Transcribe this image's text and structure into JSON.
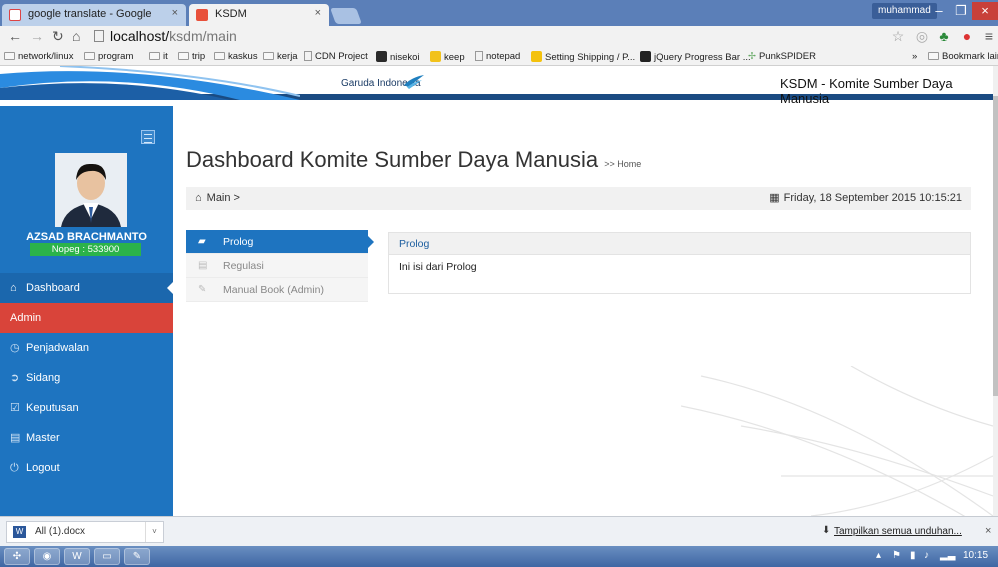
{
  "browser": {
    "tabs": [
      {
        "title": "google translate - Google",
        "active": false
      },
      {
        "title": "KSDM",
        "active": true
      }
    ],
    "user_badge": "muhammad",
    "url_host": "localhost/",
    "url_path": "ksdm/main",
    "bookmarks": [
      {
        "label": "network/linux",
        "kind": "folder"
      },
      {
        "label": "program",
        "kind": "folder"
      },
      {
        "label": "it",
        "kind": "folder"
      },
      {
        "label": "trip",
        "kind": "folder"
      },
      {
        "label": "kaskus",
        "kind": "folder"
      },
      {
        "label": "kerja",
        "kind": "folder"
      },
      {
        "label": "CDN Project",
        "kind": "page"
      },
      {
        "label": "nisekoi",
        "kind": "site"
      },
      {
        "label": "keep",
        "kind": "site"
      },
      {
        "label": "notepad",
        "kind": "page"
      },
      {
        "label": "Setting Shipping / P...",
        "kind": "site"
      },
      {
        "label": "jQuery Progress Bar ...",
        "kind": "site"
      },
      {
        "label": "PunkSPIDER",
        "kind": "site"
      }
    ],
    "bookmarks_overflow": "»",
    "bookmarks_other": "Bookmark lain"
  },
  "header": {
    "logo_text": "Garuda Indonesia",
    "site_title": "KSDM - Komite Sumber Daya Manusia"
  },
  "sidebar": {
    "user_name": "AZSAD BRACHMANTO",
    "nopeg": "Nopeg : 533900",
    "items": [
      {
        "label": "Dashboard",
        "icon": "home-icon",
        "glyph": "⌂",
        "state": "active"
      },
      {
        "label": "Admin",
        "icon": "",
        "glyph": "",
        "state": "section"
      },
      {
        "label": "Penjadwalan",
        "icon": "clock-icon",
        "glyph": "◷",
        "state": "normal"
      },
      {
        "label": "Sidang",
        "icon": "circle-arrow-icon",
        "glyph": "➲",
        "state": "normal"
      },
      {
        "label": "Keputusan",
        "icon": "checkbox-icon",
        "glyph": "☑",
        "state": "normal"
      },
      {
        "label": "Master",
        "icon": "briefcase-icon",
        "glyph": "▤",
        "state": "normal"
      },
      {
        "label": "Logout",
        "icon": "power-icon",
        "glyph": "⏻",
        "state": "normal"
      }
    ]
  },
  "main": {
    "title": "Dashboard Komite Sumber Daya Manusia",
    "title_suffix": ">> Home",
    "breadcrumb": "Main >",
    "datetime": "Friday, 18 September 2015 10:15:21",
    "tabs": [
      {
        "label": "Prolog",
        "active": true
      },
      {
        "label": "Regulasi",
        "active": false
      },
      {
        "label": "Manual Book (Admin)",
        "active": false
      }
    ],
    "panel_title": "Prolog",
    "panel_body": "Ini isi dari Prolog"
  },
  "downloads": {
    "file": "All (1).docx",
    "show_all": "Tampilkan semua unduhan...",
    "close": "×"
  },
  "taskbar": {
    "clock": "10:15"
  },
  "colors": {
    "primary": "#1e74c0",
    "admin": "#d9443a",
    "nopeg": "#2bb34a",
    "header_bar": "#1a4b82"
  }
}
